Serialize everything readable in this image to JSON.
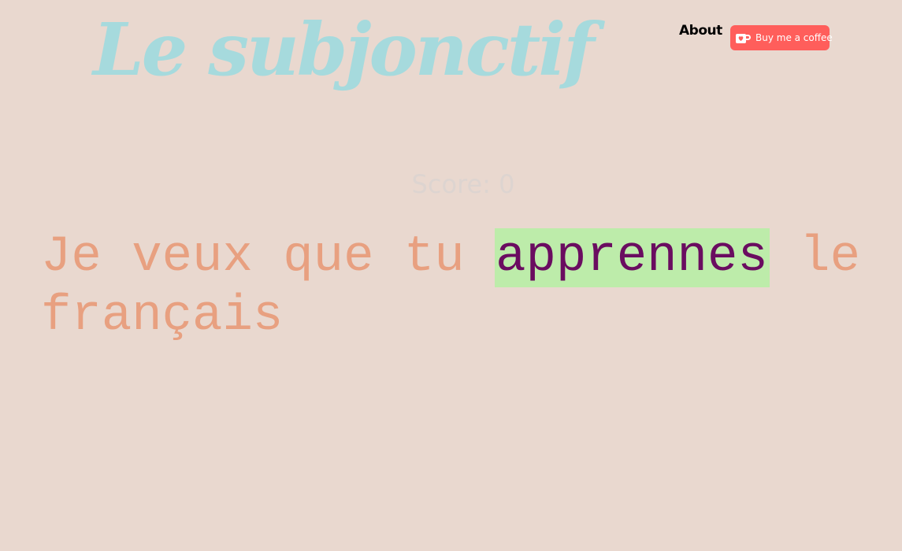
{
  "header": {
    "logo_text": "Le subjonctif",
    "nav_about": "About",
    "coffee_button": {
      "label": "Buy me a coffee",
      "icon": "ko-fi-cup-icon",
      "background": "#ff5e5b"
    }
  },
  "score": {
    "text": "Score: 0"
  },
  "sentence": {
    "before": "Je veux que tu ",
    "answer": "apprennes",
    "after": " le français"
  },
  "colors": {
    "background": "#e9d8cf",
    "logo": "#a6dadd",
    "sentence_text": "#e8a080",
    "answer_text": "#6a0c60",
    "answer_highlight": "#bdecaa",
    "score": "#ddd4d0"
  }
}
